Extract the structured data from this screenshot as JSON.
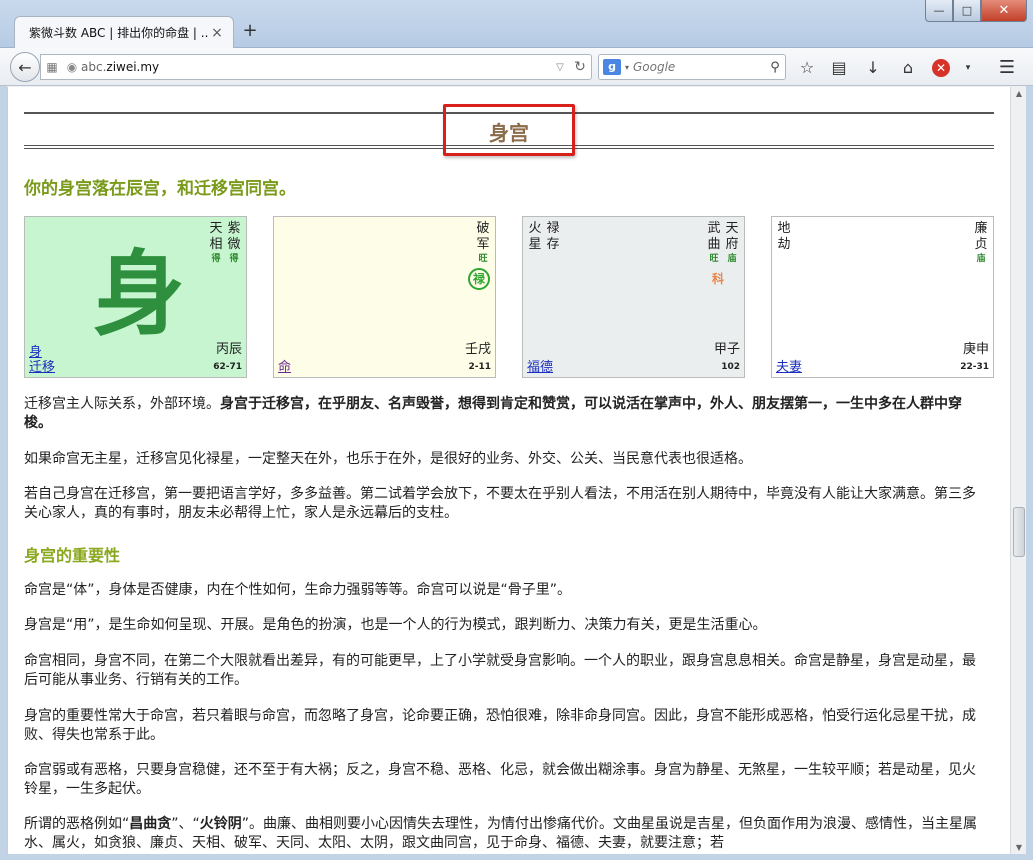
{
  "browser": {
    "tab_title": "紫微斗数 ABC | 排出你的命盘 | ...",
    "tab_close": "×",
    "new_tab": "+",
    "url_prefix": "abc.",
    "url_domain": "ziwei.my",
    "search_engine": "g",
    "search_placeholder": "Google"
  },
  "page": {
    "section_title": "身宫",
    "subtitle": "你的身宫落在辰宫，和迁移宫同宫。",
    "palaces": [
      {
        "stars": [
          {
            "name": "天相",
            "bright": "得"
          },
          {
            "name": "紫微",
            "bright": "得"
          }
        ],
        "big_char": "身",
        "body_label": "身",
        "link": "迁移",
        "ganzhi": "丙辰",
        "age": "62-71"
      },
      {
        "stars": [
          {
            "name": "破军",
            "bright": "旺"
          }
        ],
        "transform": "禄",
        "link": "命",
        "ganzhi": "壬戌",
        "age": "2-11"
      },
      {
        "left_stars": [
          {
            "name": "禄存"
          },
          {
            "name": "火星"
          }
        ],
        "stars": [
          {
            "name": "天府",
            "bright": "庙"
          },
          {
            "name": "武曲",
            "bright": "旺"
          }
        ],
        "transform": "科",
        "link": "福德",
        "ganzhi": "甲子",
        "age": "102"
      },
      {
        "left_stars": [
          {
            "name": "地劫"
          }
        ],
        "stars": [
          {
            "name": "廉贞",
            "bright": "庙"
          }
        ],
        "link": "夫妻",
        "ganzhi": "庚申",
        "age": "22-31"
      }
    ],
    "p1_plain": "迁移宫主人际关系，外部环境。",
    "p1_bold": "身宫于迁移宫，在乎朋友、名声毁誉，想得到肯定和赞赏，可以说活在掌声中，外人、朋友摆第一，一生中多在人群中穿梭。",
    "p2": "如果命宫无主星，迁移宫见化禄星，一定整天在外，也乐于在外，是很好的业务、外交、公关、当民意代表也很适格。",
    "p3": "若自己身宫在迁移宫，第一要把语言学好，多多益善。第二试着学会放下，不要太在乎别人看法，不用活在别人期待中，毕竟没有人能让大家满意。第三多关心家人，真的有事时，朋友未必帮得上忙，家人是永远幕后的支柱。",
    "heading2": "身宫的重要性",
    "p4": "命宫是“体”，身体是否健康，内在个性如何，生命力强弱等等。命宫可以说是“骨子里”。",
    "p5": "身宫是“用”，是生命如何呈现、开展。是角色的扮演，也是一个人的行为模式，跟判断力、决策力有关，更是生活重心。",
    "p6": "命宫相同，身宫不同，在第二个大限就看出差异，有的可能更早，上了小学就受身宫影响。一个人的职业，跟身宫息息相关。命宫是静星，身宫是动星，最后可能从事业务、行销有关的工作。",
    "p7": "身宫的重要性常大于命宫，若只着眼与命宫，而忽略了身宫，论命要正确，恐怕很难，除非命身同宫。因此，身宫不能形成恶格，怕受行运化忌星干扰，成败、得失也常系于此。",
    "p8": "命宫弱或有恶格，只要身宫稳健，还不至于有大祸；反之，身宫不稳、恶格、化忌，就会做出糊涂事。身宫为静星、无煞星，一生较平顺；若是动星，见火铃星，一生多起伏。",
    "p9_a": "所谓的恶格例如“",
    "p9_b1": "昌曲贪",
    "p9_c": "”、“",
    "p9_b2": "火铃阴",
    "p9_d": "”。曲廉、曲相则要小心因情失去理性，为情付出惨痛代价。文曲星虽说是吉星，但负面作用为浪漫、感情性，当主星属水、属火，如贪狼、廉贞、天相、破军、天同、太阳、太阴，跟文曲同宫，见于命身、福德、夫妻，就要注意；若"
  }
}
